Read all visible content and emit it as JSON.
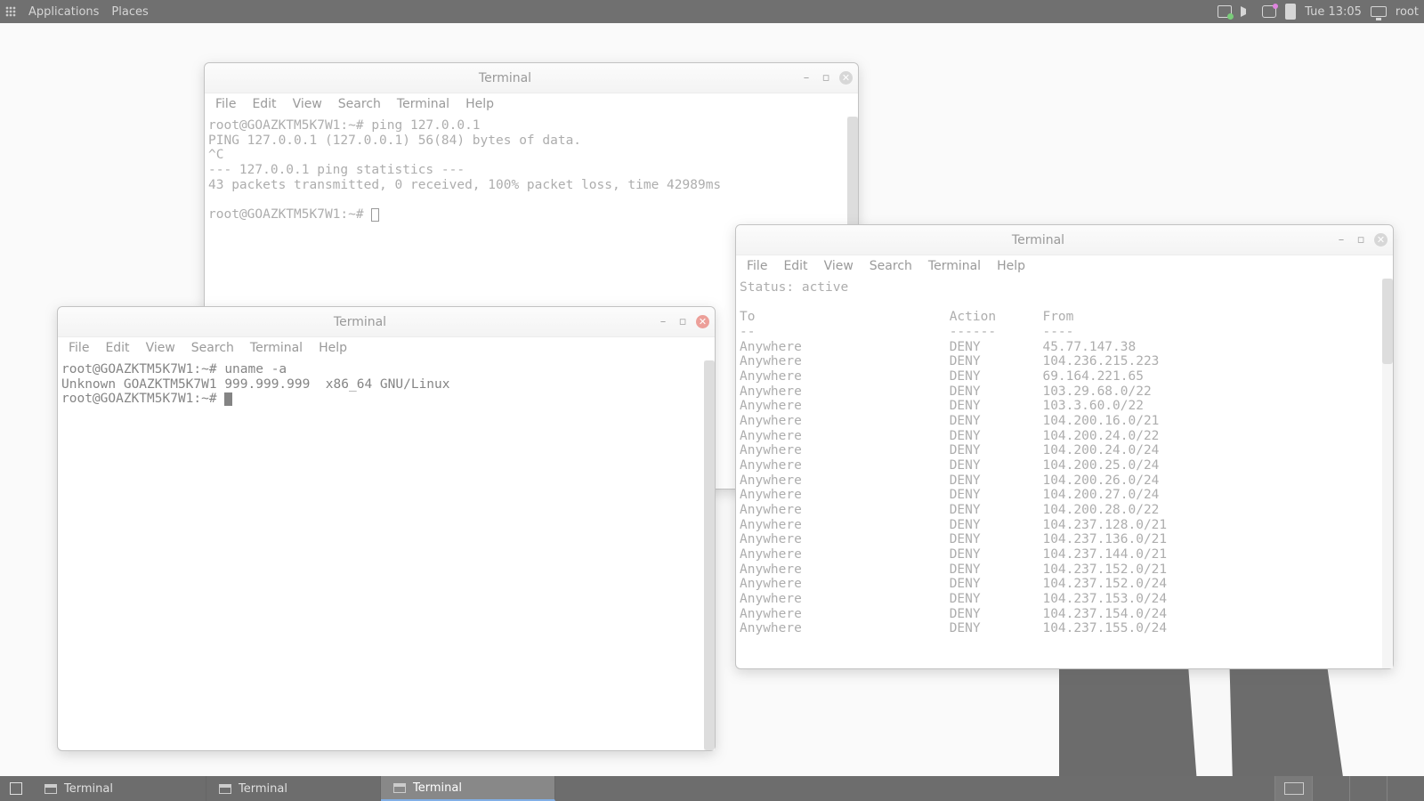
{
  "topbar": {
    "applications": "Applications",
    "places": "Places",
    "clock": "Tue 13:05",
    "user": "root"
  },
  "menus": [
    "File",
    "Edit",
    "View",
    "Search",
    "Terminal",
    "Help"
  ],
  "window_title": "Terminal",
  "term1": {
    "lines": [
      "root@GOAZKTM5K7W1:~# ping 127.0.0.1",
      "PING 127.0.0.1 (127.0.0.1) 56(84) bytes of data.",
      "^C",
      "--- 127.0.0.1 ping statistics ---",
      "43 packets transmitted, 0 received, 100% packet loss, time 42989ms",
      "",
      "root@GOAZKTM5K7W1:~# "
    ]
  },
  "term2": {
    "lines": [
      "root@GOAZKTM5K7W1:~# uname -a",
      "Unknown GOAZKTM5K7W1 999.999.999  x86_64 GNU/Linux",
      "root@GOAZKTM5K7W1:~# "
    ]
  },
  "term3": {
    "status": "Status: active",
    "header": {
      "to": "To",
      "action": "Action",
      "from": "From"
    },
    "divider": {
      "to": "--",
      "action": "------",
      "from": "----"
    },
    "rules": [
      {
        "to": "Anywhere",
        "action": "DENY",
        "from": "45.77.147.38"
      },
      {
        "to": "Anywhere",
        "action": "DENY",
        "from": "104.236.215.223"
      },
      {
        "to": "Anywhere",
        "action": "DENY",
        "from": "69.164.221.65"
      },
      {
        "to": "Anywhere",
        "action": "DENY",
        "from": "103.29.68.0/22"
      },
      {
        "to": "Anywhere",
        "action": "DENY",
        "from": "103.3.60.0/22"
      },
      {
        "to": "Anywhere",
        "action": "DENY",
        "from": "104.200.16.0/21"
      },
      {
        "to": "Anywhere",
        "action": "DENY",
        "from": "104.200.24.0/22"
      },
      {
        "to": "Anywhere",
        "action": "DENY",
        "from": "104.200.24.0/24"
      },
      {
        "to": "Anywhere",
        "action": "DENY",
        "from": "104.200.25.0/24"
      },
      {
        "to": "Anywhere",
        "action": "DENY",
        "from": "104.200.26.0/24"
      },
      {
        "to": "Anywhere",
        "action": "DENY",
        "from": "104.200.27.0/24"
      },
      {
        "to": "Anywhere",
        "action": "DENY",
        "from": "104.200.28.0/22"
      },
      {
        "to": "Anywhere",
        "action": "DENY",
        "from": "104.237.128.0/21"
      },
      {
        "to": "Anywhere",
        "action": "DENY",
        "from": "104.237.136.0/21"
      },
      {
        "to": "Anywhere",
        "action": "DENY",
        "from": "104.237.144.0/21"
      },
      {
        "to": "Anywhere",
        "action": "DENY",
        "from": "104.237.152.0/21"
      },
      {
        "to": "Anywhere",
        "action": "DENY",
        "from": "104.237.152.0/24"
      },
      {
        "to": "Anywhere",
        "action": "DENY",
        "from": "104.237.153.0/24"
      },
      {
        "to": "Anywhere",
        "action": "DENY",
        "from": "104.237.154.0/24"
      },
      {
        "to": "Anywhere",
        "action": "DENY",
        "from": "104.237.155.0/24"
      }
    ]
  },
  "taskbar": {
    "items": [
      "Terminal",
      "Terminal",
      "Terminal"
    ]
  }
}
